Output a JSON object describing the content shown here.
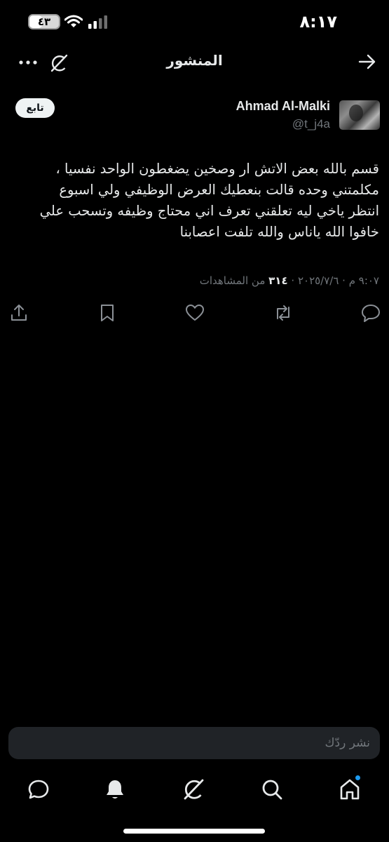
{
  "status_bar": {
    "time": "٨:١٧",
    "battery_level": "٤٣",
    "battery_percent": 43,
    "icons": [
      "battery-icon",
      "wifi-icon",
      "cellular-signal-icon"
    ]
  },
  "header": {
    "title": "المنشور",
    "icons": [
      "back-arrow-icon",
      "grok-icon",
      "more-icon"
    ]
  },
  "post": {
    "author": {
      "name": "Ahmad Al-Malki",
      "handle": "@t_j4a"
    },
    "follow_label": "تابع",
    "text": "قسم بالله بعض الاتش ار وصخين يضغطون الواحد نفسيا ،\nمكلمتني وحده قالت بنعطيك العرض الوظيفي ولي اسبوع\nانتظر ياخي ليه تعلقني تعرف اني محتاج وظيفه وتسحب علي\nخافوا الله ياناس والله تلفت اعصابنا",
    "timestamp": "٩:٠٧ م · ٢٠٢٥/٧/٦ ·",
    "views_count": "٣١٤",
    "views_label": "من المشاهدات"
  },
  "actions": {
    "icons": [
      "reply-icon",
      "repost-icon",
      "like-icon",
      "bookmark-icon",
      "share-icon"
    ]
  },
  "reply": {
    "placeholder": "نشر ردّك"
  },
  "tab_bar": {
    "items": [
      "home-icon",
      "search-icon",
      "grok-icon",
      "notifications-icon",
      "messages-icon"
    ]
  },
  "colors": {
    "background": "#000000",
    "text": "#e7e9ea",
    "muted": "#71767b",
    "accent": "#1d9bf0",
    "input_bg": "#202327"
  }
}
